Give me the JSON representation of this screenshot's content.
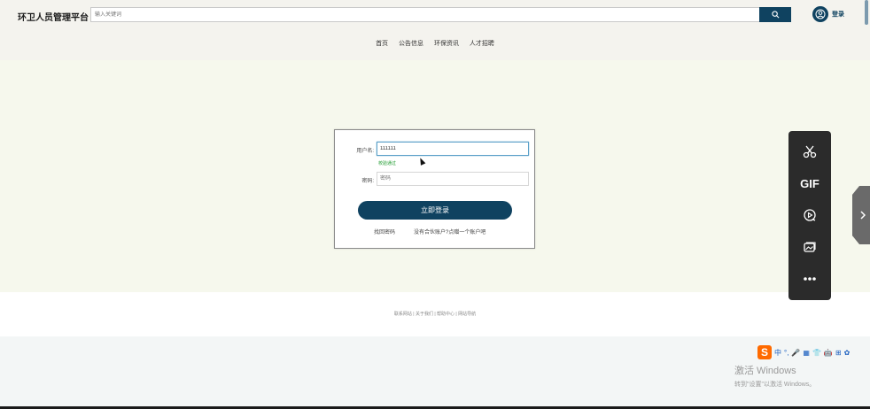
{
  "header": {
    "brand": "环卫人员管理平台",
    "search_placeholder": "输入关键词",
    "login_label": "登录"
  },
  "nav": [
    "首页",
    "公告信息",
    "环保资讯",
    "人才招聘"
  ],
  "login_form": {
    "username_label": "用户名:",
    "username_value": "111111",
    "username_hint": "校验通过",
    "password_label": "密码:",
    "password_placeholder": "密码",
    "submit_label": "立即登录",
    "forgot_link": "找回密码",
    "register_link": "没有合伙账户?点赠一个账户吧"
  },
  "footer": {
    "text": "联系网站 | 关于我们 | 帮助中心 | 网站导航"
  },
  "toolbar": {
    "gif_label": "GIF"
  },
  "tray": [
    "中",
    "°,",
    "🎤",
    "▦",
    "👕",
    "🤖",
    "⊞",
    "✿"
  ],
  "tray_logo": "S",
  "watermark": {
    "line1": "激活 Windows",
    "line2": "转到\"设置\"以激活 Windows。"
  },
  "colors": {
    "primary": "#0f4260",
    "header_bg": "#f4f3ee",
    "main_bg": "#f6f8ed",
    "hint_green": "#1d9a2d"
  }
}
